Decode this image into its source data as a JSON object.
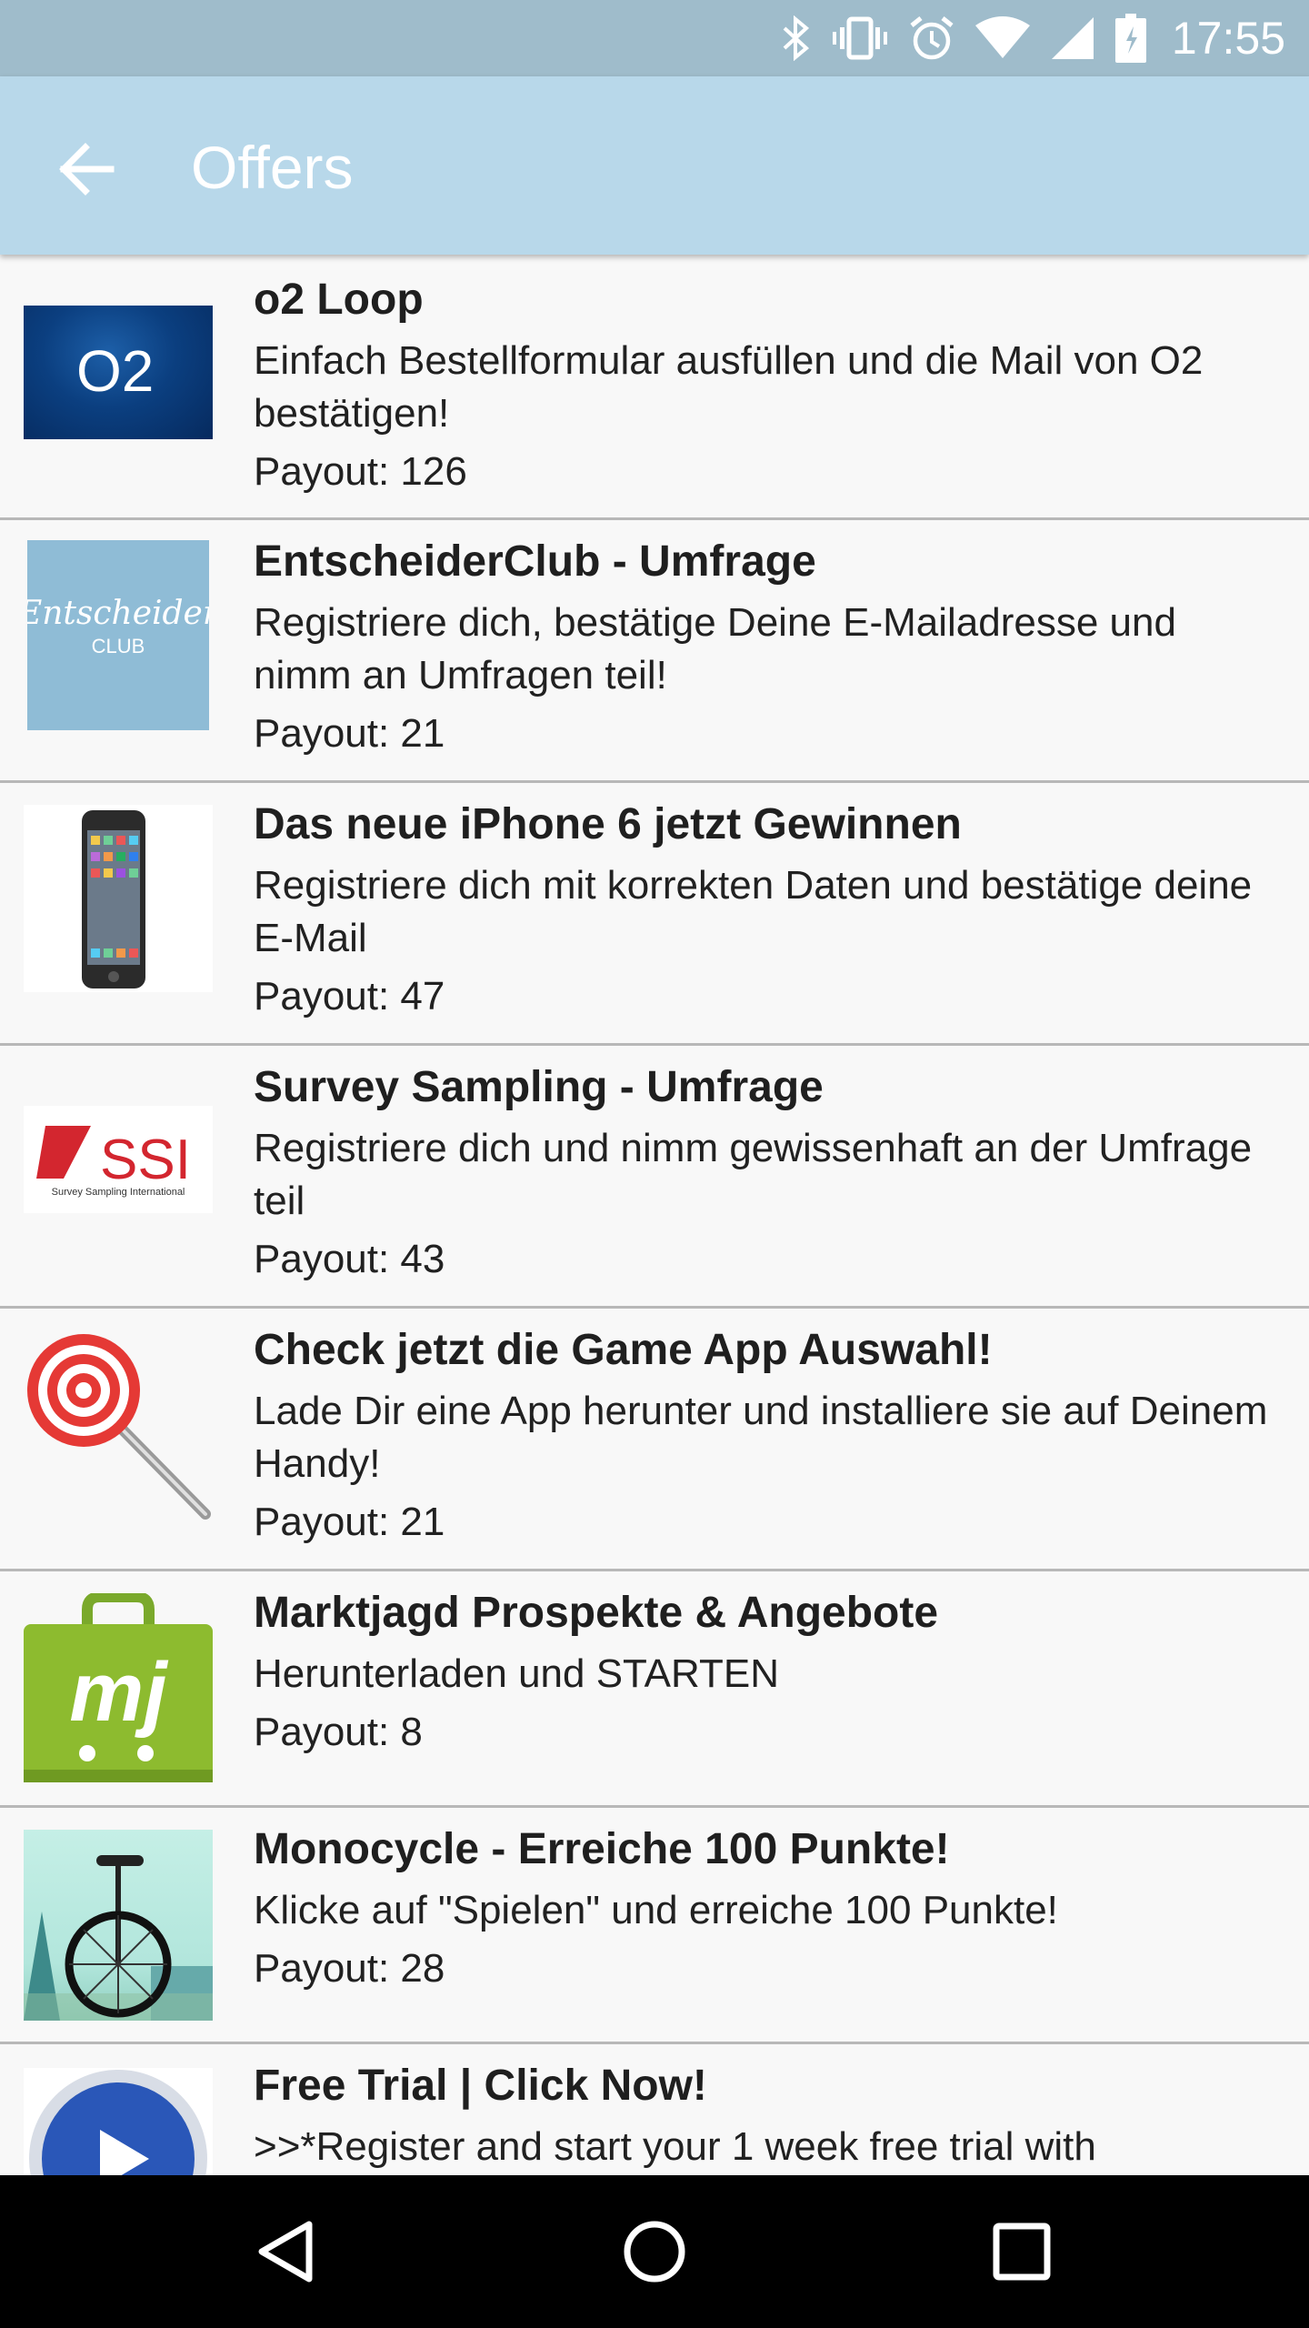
{
  "status_bar": {
    "time": "17:55",
    "icons": [
      "bluetooth-icon",
      "vibrate-icon",
      "alarm-icon",
      "wifi-icon",
      "signal-icon",
      "battery-icon"
    ]
  },
  "app_bar": {
    "title": "Offers",
    "back_icon": "arrow-back-icon"
  },
  "offers": [
    {
      "title": "o2 Loop",
      "description": "Einfach Bestellformular ausfüllen und die Mail von O2 bestätigen!",
      "payout": "Payout: 126",
      "logo_text": "O2"
    },
    {
      "title": "EntscheiderClub - Umfrage",
      "description": "Registriere dich, bestätige Deine E-Mailadresse und nimm an Umfragen teil!",
      "payout": "Payout: 21",
      "logo_text": "Entscheider",
      "logo_subtext": "CLUB"
    },
    {
      "title": "Das neue iPhone 6 jetzt Gewinnen",
      "description": "Registriere dich mit korrekten Daten und bestätige deine E-Mail",
      "payout": "Payout: 47"
    },
    {
      "title": "Survey Sampling - Umfrage",
      "description": "Registriere dich und nimm gewissenhaft an der Umfrage teil",
      "payout": "Payout: 43",
      "logo_text": "SSI",
      "logo_subtext": "Survey Sampling International"
    },
    {
      "title": "Check jetzt die Game App Auswahl!",
      "description": "Lade Dir eine App herunter und installiere sie auf Deinem Handy!",
      "payout": "Payout: 21"
    },
    {
      "title": "Marktjagd Prospekte & Angebote",
      "description": "Herunterladen und STARTEN",
      "payout": "Payout: 8",
      "logo_text": "mj"
    },
    {
      "title": "Monocycle - Erreiche 100 Punkte!",
      "description": "Klicke auf \"Spielen\" und erreiche 100 Punkte!",
      "payout": "Payout: 28"
    },
    {
      "title": "Free Trial | Click Now!",
      "description": ">>*Register and start your 1 week free trial with",
      "payout": ""
    }
  ],
  "nav_bar": {
    "back_icon": "nav-back-icon",
    "home_icon": "nav-home-icon",
    "recents_icon": "nav-recents-icon"
  },
  "colors": {
    "status_bar": "#9fbccb",
    "app_bar": "#b8d8ea",
    "list_background": "#f8f8f8",
    "divider": "#b8b8b8"
  }
}
